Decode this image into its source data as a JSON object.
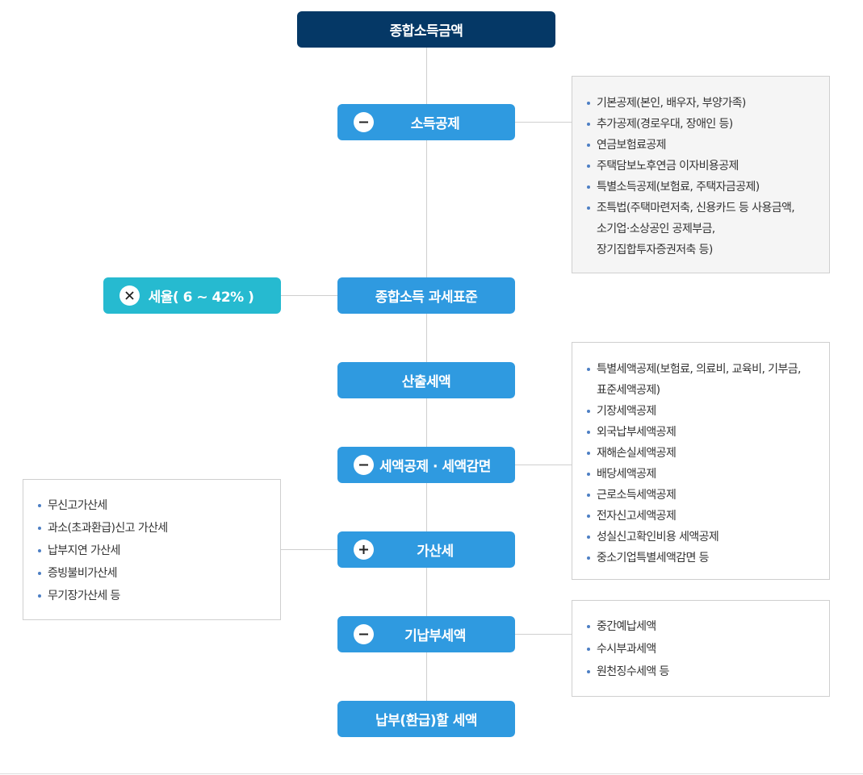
{
  "nodes": {
    "total_income": "종합소득금액",
    "income_deduction": "소득공제",
    "tax_base": "종합소득 과세표준",
    "tax_rate": "세율( 6 ~ 42% )",
    "calculated_tax": "산출세액",
    "tax_credit": "세액공제 · 세액감면",
    "penalty_tax": "가산세",
    "prepaid_tax": "기납부세액",
    "payable_tax": "납부(환급)할 세액"
  },
  "icons": {
    "minus": "minus-circle-icon",
    "plus": "plus-circle-icon",
    "times": "times-circle-icon"
  },
  "colors": {
    "dark_navy": "#053866",
    "blue": "#2f9ae0",
    "teal": "#26bad0",
    "bullet": "#4d7fc4"
  },
  "boxes": {
    "income_deduction_items": [
      "기본공제(본인, 배우자, 부양가족)",
      "추가공제(경로우대, 장애인 등)",
      "연금보험료공제",
      "주택담보노후연금 이자비용공제",
      "특별소득공제(보험료, 주택자금공제)",
      "조특법(주택마련저축, 신용카드 등 사용금액,",
      "소기업·소상공인 공제부금,",
      "장기집합투자증권저축 등)"
    ],
    "tax_credit_items": [
      "특별세액공제(보험료, 의료비, 교육비, 기부금,",
      "표준세액공제)",
      "기장세액공제",
      "외국납부세액공제",
      "재해손실세액공제",
      "배당세액공제",
      "근로소득세액공제",
      "전자신고세액공제",
      "성실신고확인비용 세액공제",
      "중소기업특별세액감면 등"
    ],
    "penalty_items": [
      "무신고가산세",
      "과소(초과환급)신고 가산세",
      "납부지연 가산세",
      "증빙불비가산세",
      "무기장가산세 등"
    ],
    "prepaid_items": [
      "중간예납세액",
      "수시부과세액",
      "원천징수세액 등"
    ]
  }
}
